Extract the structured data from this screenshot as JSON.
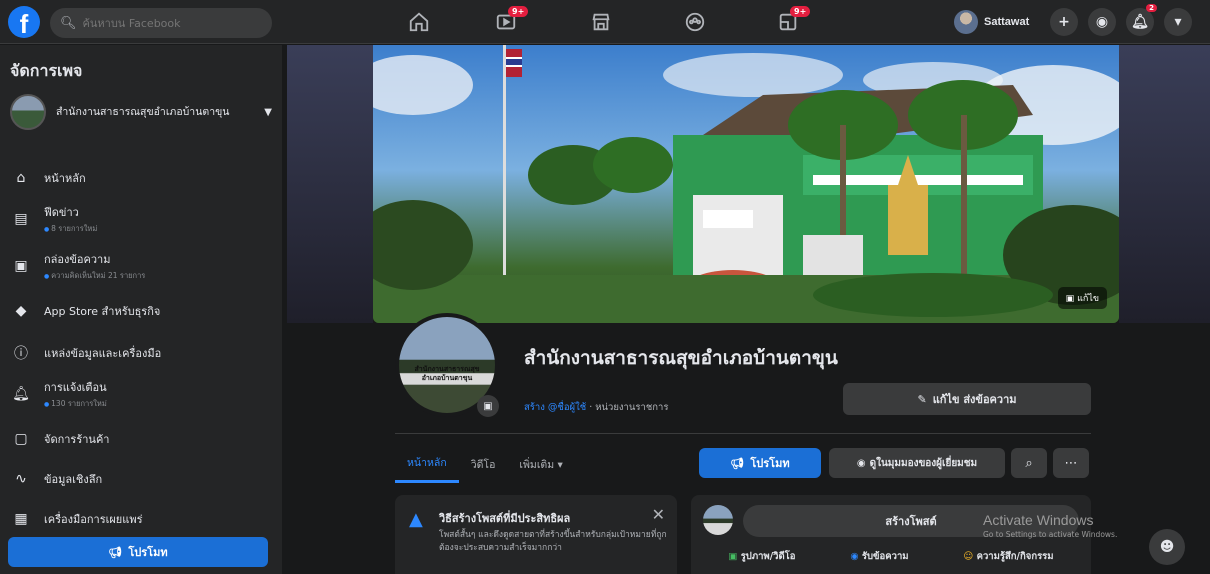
{
  "topbar": {
    "search_placeholder": "ค้นหาบน Facebook",
    "nav_badges": [
      "9+",
      "9+"
    ],
    "profile_name": "Sattawat",
    "notif_badge": "2"
  },
  "sidebar": {
    "title": "จัดการเพจ",
    "page_name": "สำนักงานสาธารณสุขอำเภอบ้านตาขุน",
    "items": [
      {
        "label": "หน้าหลัก",
        "sub": "",
        "icon": "home-icon"
      },
      {
        "label": "ฟีดข่าว",
        "sub": "8 รายการใหม่",
        "icon": "news-feed-icon"
      },
      {
        "label": "กล่องข้อความ",
        "sub": "ความคิดเห็นใหม่ 21 รายการ",
        "icon": "inbox-icon"
      },
      {
        "label": "App Store สำหรับธุรกิจ",
        "sub": "",
        "icon": "app-store-icon"
      },
      {
        "label": "แหล่งข้อมูลและเครื่องมือ",
        "sub": "",
        "icon": "info-icon"
      },
      {
        "label": "การแจ้งเตือน",
        "sub": "130 รายการใหม่",
        "icon": "bell-icon"
      },
      {
        "label": "จัดการร้านค้า",
        "sub": "",
        "icon": "shop-icon"
      },
      {
        "label": "ข้อมูลเชิงลึก",
        "sub": "",
        "icon": "insights-icon"
      },
      {
        "label": "เครื่องมือการเผยแพร่",
        "sub": "",
        "icon": "publishing-tools-icon"
      }
    ],
    "promote_label": "โปรโมท"
  },
  "main": {
    "edit_cover_label": "แก้ไข",
    "avatar_text": "สำนักงานสาธารณสุขอำเภอบ้านตาขุน",
    "page_name": "สำนักงานสาธารณสุขอำเภอบ้านตาขุน",
    "page_meta_link": "สร้าง @ชื่อผู้ใช้",
    "page_meta_category": " · หน่วยงานราชการ",
    "edit_send_label": "แก้ไข ส่งข้อความ",
    "tabs": [
      "หน้าหลัก",
      "วิดีโอ",
      "เพิ่มเติม ▾"
    ],
    "promote_label": "โปรโมท",
    "view_as_label": "ดูในมุมมองของผู้เยี่ยมชม",
    "tip": {
      "title": "วิธีสร้างโพสต์ที่มีประสิทธิผล",
      "body": "โพสต์สั้นๆ และดึงดูดสายตาที่สร้างขึ้นสำหรับกลุ่มเป้าหมายที่ถูกต้องจะประสบความสำเร็จมากกว่า"
    },
    "create_post": {
      "label": "สร้างโพสต์",
      "actions": [
        "รูปภาพ/วิดีโอ",
        "รับข้อความ",
        "ความรู้สึก/กิจกรรม"
      ]
    },
    "activate": {
      "title": "Activate Windows",
      "sub": "Go to Settings to activate Windows."
    }
  }
}
